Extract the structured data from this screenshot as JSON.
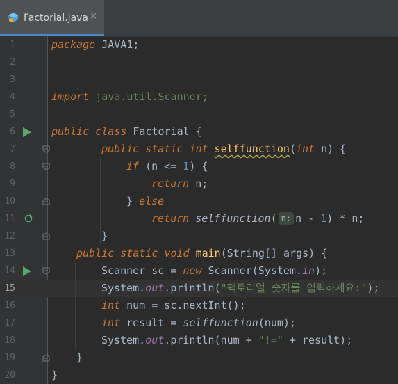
{
  "tab": {
    "title": "Factorial.java",
    "close": "×",
    "icon": "java-class-icon"
  },
  "colors": {
    "background": "#2b2b2b",
    "keyword": "#cc7832",
    "string": "#6a8759",
    "number": "#6897bb",
    "field": "#9876aa",
    "method": "#ffc66d",
    "text": "#a9b7c6"
  },
  "line_numbers": [
    "1",
    "2",
    "3",
    "4",
    "5",
    "6",
    "7",
    "8",
    "9",
    "10",
    "11",
    "12",
    "13",
    "14",
    "15",
    "16",
    "17",
    "18",
    "19",
    "20"
  ],
  "current_line": "15",
  "code": {
    "l1": {
      "kw": "package",
      "rest": " JAVA1;"
    },
    "l4": {
      "kw": "import",
      "rest": " java.util.Scanner;"
    },
    "l6": {
      "kw1": "public",
      "kw2": "class",
      "name": " Factorial {"
    },
    "l7": {
      "kw1": "public",
      "kw2": "static",
      "kw3": "int",
      "method": "selffunction",
      "kw4": "int",
      "rest": " n) {"
    },
    "l8": {
      "kw": "if",
      "pre": " (n <= ",
      "num": "1",
      "post": ") {"
    },
    "l9": {
      "kw": "return",
      "rest": " n;"
    },
    "l10": {
      "pre": "} ",
      "kw": "else"
    },
    "l11": {
      "kw": "return",
      "method": "selffunction",
      "hint": "n:",
      "pre": "n - ",
      "num": "1",
      "post": ") * n;"
    },
    "l12": {
      "text": "}"
    },
    "l13": {
      "kw1": "public",
      "kw2": "static",
      "kw3": "void",
      "method": "main",
      "rest": "(String[] args) {"
    },
    "l14": {
      "pre": "Scanner sc = ",
      "kw": "new",
      "post": " Scanner(System.",
      "fld": "in",
      "end": ");"
    },
    "l15": {
      "pre": "System.",
      "fld": "out",
      "mid": ".println(",
      "str": "\"팩토리얼 숫자를 입력하세요:\"",
      "end": ");"
    },
    "l16": {
      "kw": "int",
      "rest": " num = sc.nextInt();"
    },
    "l17": {
      "kw": "int",
      "pre": " result = ",
      "method": "selffunction",
      "rest": "(num);"
    },
    "l18": {
      "pre": "System.",
      "fld": "out",
      "mid": ".println(num + ",
      "str": "\"!=\"",
      "end": " + result);"
    },
    "l19": {
      "text": "}"
    },
    "l20": {
      "text": "}"
    }
  }
}
